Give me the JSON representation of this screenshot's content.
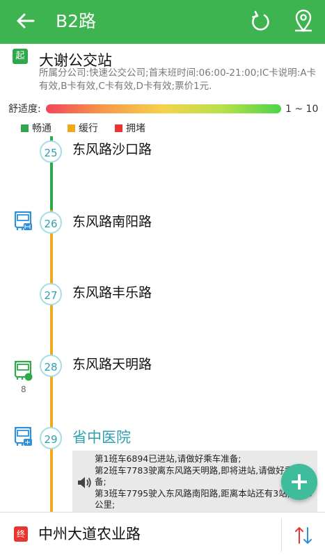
{
  "header": {
    "title": "B2路",
    "back_icon": "back-arrow-icon",
    "refresh_icon": "refresh-icon",
    "locate_icon": "location-pin-icon"
  },
  "start": {
    "badge": "起",
    "name": "大谢公交站"
  },
  "info": "所属分公司:快速公交公司;首末班时间:06:00-21:00;IC卡说明:A卡有效,B卡有效,C卡有效,D卡有效;票价1元.",
  "comfort": {
    "label": "舒适度:",
    "range": "1 ~ 10"
  },
  "legend": [
    {
      "label": "畅通",
      "color": "#2ea84a"
    },
    {
      "label": "缓行",
      "color": "#f0a81c"
    },
    {
      "label": "拥堵",
      "color": "#e8352f"
    }
  ],
  "stops": [
    {
      "num": "25",
      "name": "东风路沙口路"
    },
    {
      "num": "26",
      "name": "东风路南阳路"
    },
    {
      "num": "27",
      "name": "东风路丰乐路"
    },
    {
      "num": "28",
      "name": "东风路天明路"
    },
    {
      "num": "29",
      "name": "省中医院"
    }
  ],
  "bus_count": "8",
  "notice": [
    "第1班车6894已进站,请做好乘车准备;",
    "第2班车7783驶离东风路天明路,即将进站,请做好乘车准备;",
    "第3班车7795驶入东风路南阳路,距离本站还有3站,共2.0公里;"
  ],
  "end": {
    "badge": "终",
    "name": "中州大道农业路"
  },
  "colors": {
    "primary": "#3eb450",
    "smooth": "#2ea84a",
    "slow": "#f0a81c",
    "jam": "#e8352f",
    "stop_accent": "#2f9fb0",
    "fab": "#3ebc9c"
  }
}
